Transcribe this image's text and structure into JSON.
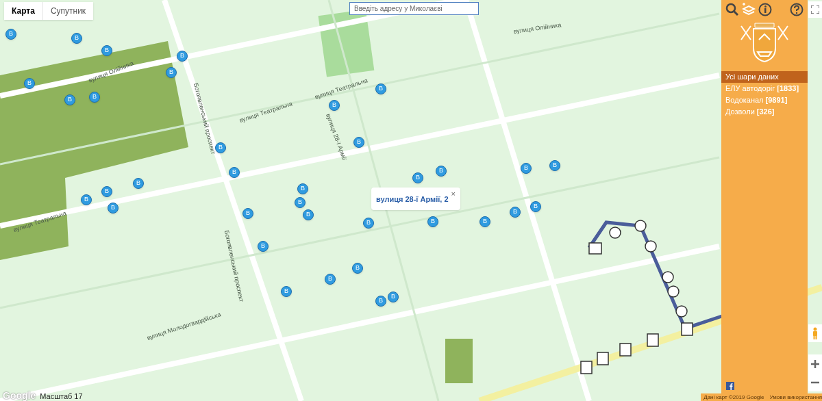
{
  "map_type_tabs": [
    {
      "label": "Карта",
      "selected": true
    },
    {
      "label": "Супутник",
      "selected": false
    }
  ],
  "search": {
    "placeholder": "Введіть адресу у Миколаєві"
  },
  "popup": {
    "text": "вулиця 28-ї Армії, 2",
    "close": "×"
  },
  "streets": [
    {
      "name": "вулиця Олійника"
    },
    {
      "name": "вулиця Театральна"
    },
    {
      "name": "вулиця Театральна"
    },
    {
      "name": "Богоявленський проспект"
    },
    {
      "name": "Богоявленський проспект"
    },
    {
      "name": "вулиця Молодогвардійська"
    },
    {
      "name": "вулиця 28-ї Армії"
    },
    {
      "name": "вулиця Театральна"
    },
    {
      "name": "вулиця Олійника"
    }
  ],
  "markers": [
    {
      "label": "В"
    },
    {
      "label": "В"
    },
    {
      "label": "В"
    },
    {
      "label": "В"
    },
    {
      "label": "В"
    },
    {
      "label": "В"
    },
    {
      "label": "В"
    },
    {
      "label": "В"
    },
    {
      "label": "В"
    },
    {
      "label": "В"
    },
    {
      "label": "В"
    },
    {
      "label": "В"
    },
    {
      "label": "В"
    },
    {
      "label": "В"
    },
    {
      "label": "В"
    },
    {
      "label": "В"
    },
    {
      "label": "В"
    },
    {
      "label": "В"
    },
    {
      "label": "В"
    },
    {
      "label": "В"
    },
    {
      "label": "В"
    },
    {
      "label": "В"
    },
    {
      "label": "В"
    },
    {
      "label": "В"
    },
    {
      "label": "В"
    },
    {
      "label": "В"
    },
    {
      "label": "В"
    },
    {
      "label": "В"
    },
    {
      "label": "В"
    },
    {
      "label": "В"
    },
    {
      "label": "В"
    },
    {
      "label": "В"
    },
    {
      "label": "В"
    },
    {
      "label": "В"
    },
    {
      "label": "В"
    },
    {
      "label": "В"
    }
  ],
  "panel": {
    "layers": [
      {
        "label": "Усі шари даних",
        "selected": true
      },
      {
        "label": "ЕЛУ автодоріг **[1833]**",
        "selected": false
      },
      {
        "label": "Водоканал **[9891]**",
        "selected": false
      },
      {
        "label": "Дозволи **[326]**",
        "selected": false
      }
    ]
  },
  "map_footer": {
    "logo": "Google",
    "scale": "Масштаб 17",
    "attribution": "Дані карт ©2019 Google",
    "terms": "Умови використання"
  }
}
